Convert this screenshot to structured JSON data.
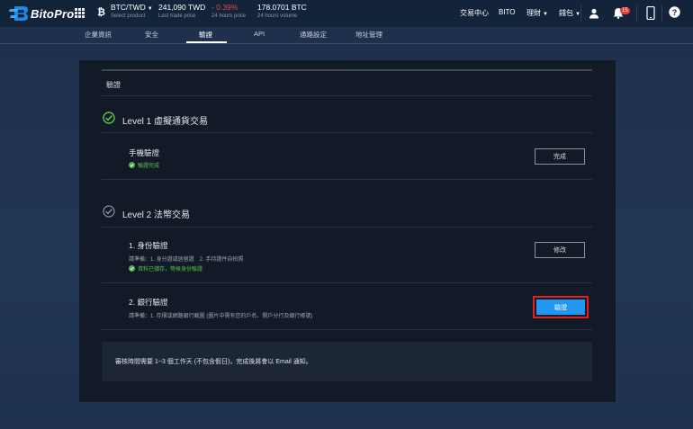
{
  "topbar": {
    "brand": "BitoPro",
    "market": {
      "pair": "BTC/TWD",
      "label": "Select product"
    },
    "last_price": {
      "value": "241,090 TWD",
      "label": "Last trade price"
    },
    "change": {
      "value": "- 0.39%",
      "label": "24 hours price"
    },
    "volume": {
      "value": "178.0701 BTC",
      "label": "24 hours volume"
    },
    "nav": {
      "exchange": "交易中心",
      "bito": "BITO",
      "finance": "理財",
      "wallet": "錢包"
    },
    "notification_count": "15"
  },
  "tabs": [
    "企業資訊",
    "安全",
    "驗證",
    "API",
    "通路設定",
    "地址管理"
  ],
  "active_tab": "驗證",
  "card": {
    "section_title": "驗證",
    "level1": {
      "title": "Level 1 虛擬通貨交易",
      "phone": {
        "title": "手機驗證",
        "status": "驗證完成",
        "button": "完成"
      }
    },
    "level2": {
      "title": "Level 2 法幣交易",
      "identity": {
        "title": "1. 身份驗證",
        "note": "請準備：1. 身分證或居留證　2. 手持證件自拍照",
        "status": "資料已儲存，等候身份驗證",
        "button": "修改"
      },
      "bank": {
        "title": "2. 銀行驗證",
        "note": "請準備：1. 存摺或網路銀行截圖 (圖片中需有您的戶名、開戶分行及銀行帳號)",
        "button": "驗證"
      }
    },
    "info": "審核時間需要 1~3 個工作天 (不包含假日)，完成後將會以 Email 通知。"
  },
  "colors": {
    "accent": "#2196f3",
    "success": "#4caf50",
    "negative": "#e64a4a",
    "highlight": "#e02020"
  }
}
